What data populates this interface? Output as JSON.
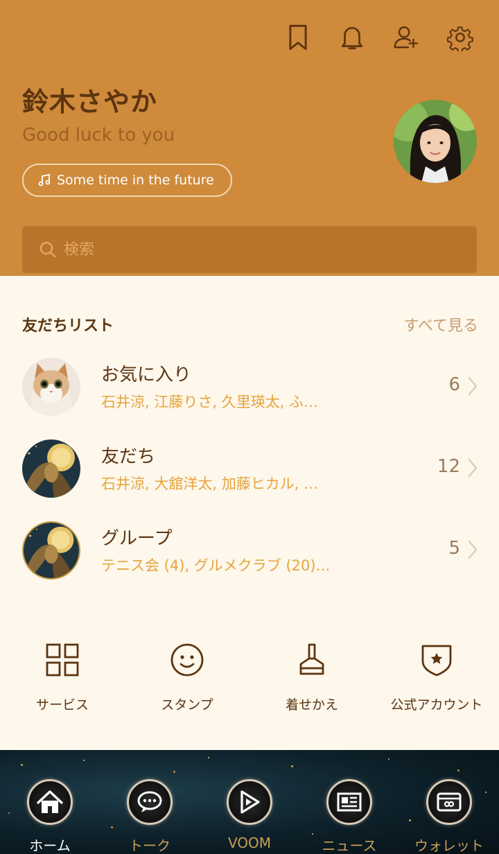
{
  "header": {
    "icons": [
      "bookmark-icon",
      "bell-icon",
      "add-friend-icon",
      "settings-icon"
    ],
    "name": "鈴木さやか",
    "status": "Good luck to you",
    "music": "Some time in the future",
    "search_placeholder": "検索"
  },
  "friends": {
    "title": "友だちリスト",
    "see_all": "すべて見る",
    "rows": [
      {
        "title": "お気に入り",
        "subtitle": "石井涼, 江藤りさ, 久里瑛太, ふ…",
        "count": "6"
      },
      {
        "title": "友だち",
        "subtitle": "石井涼, 大舘洋太, 加藤ヒカル, …",
        "count": "12"
      },
      {
        "title": "グループ",
        "subtitle": "テニス会 (4), グルメクラブ (20)…",
        "count": "5"
      }
    ]
  },
  "services": [
    {
      "label": "サービス",
      "icon": "grid-icon"
    },
    {
      "label": "スタンプ",
      "icon": "smiley-icon"
    },
    {
      "label": "着せかえ",
      "icon": "brush-icon"
    },
    {
      "label": "公式アカウント",
      "icon": "shield-star-icon"
    }
  ],
  "nav": [
    {
      "label": "ホーム",
      "icon": "home-icon",
      "active": true
    },
    {
      "label": "トーク",
      "icon": "chat-icon",
      "active": false
    },
    {
      "label": "VOOM",
      "icon": "play-icon",
      "active": false
    },
    {
      "label": "ニュース",
      "icon": "news-icon",
      "active": false
    },
    {
      "label": "ウォレット",
      "icon": "wallet-icon",
      "active": false
    }
  ],
  "colors": {
    "header_bg": "#cf8a3b",
    "page_bg": "#fdf7ec",
    "primary_text": "#5c3410",
    "accent": "#e6a53d"
  }
}
